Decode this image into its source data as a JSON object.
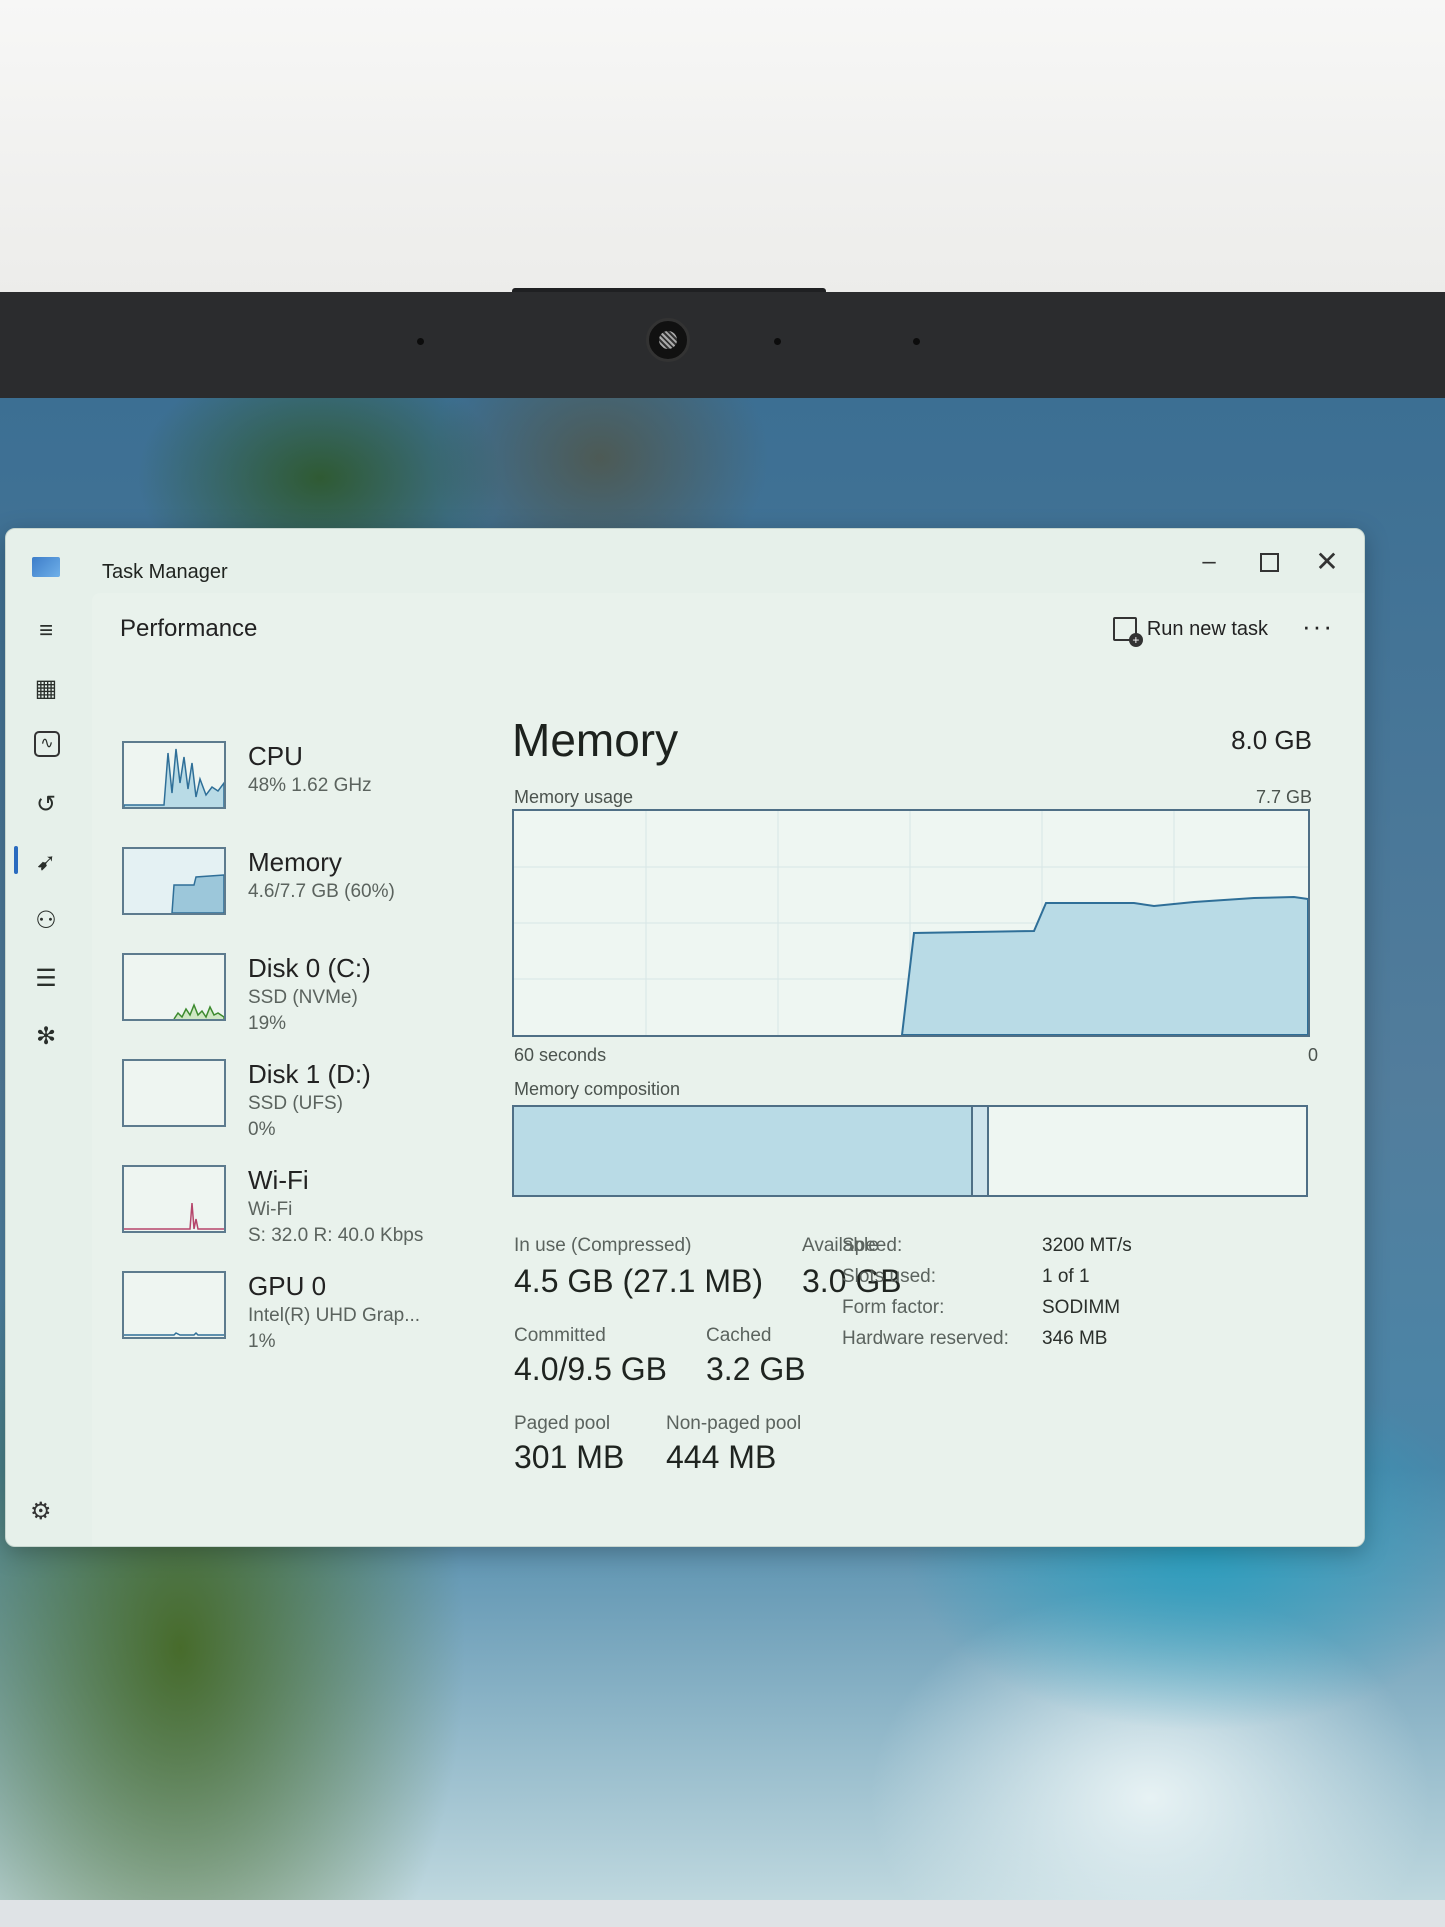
{
  "window": {
    "title": "Task Manager",
    "controls": [
      "minimize-icon",
      "maximize-icon",
      "close-icon"
    ]
  },
  "nav_icons": [
    "hamburger-icon",
    "processes-icon",
    "performance-icon",
    "app-history-icon",
    "startup-apps-icon",
    "users-icon",
    "details-icon",
    "services-icon",
    "settings-icon"
  ],
  "header": {
    "page_title": "Performance",
    "run_new_task_label": "Run new task",
    "more_label": "···"
  },
  "devices": [
    {
      "name": "CPU",
      "line1": "48%  1.62 GHz",
      "line2": ""
    },
    {
      "name": "Memory",
      "line1": "4.6/7.7 GB (60%)",
      "line2": ""
    },
    {
      "name": "Disk 0 (C:)",
      "line1": "SSD (NVMe)",
      "line2": "19%"
    },
    {
      "name": "Disk 1 (D:)",
      "line1": "SSD (UFS)",
      "line2": "0%"
    },
    {
      "name": "Wi-Fi",
      "line1": "Wi-Fi",
      "line2": "S: 32.0  R: 40.0 Kbps"
    },
    {
      "name": "GPU 0",
      "line1": "Intel(R) UHD Grap...",
      "line2": "1%"
    }
  ],
  "memory": {
    "title": "Memory",
    "total": "8.0 GB",
    "usage_label": "Memory usage",
    "usage_max": "7.7 GB",
    "axis_left": "60 seconds",
    "axis_right": "0",
    "composition_label": "Memory composition",
    "composition": {
      "in_use_fraction": 0.58,
      "modified_fraction": 0.02
    },
    "in_use_label": "In use (Compressed)",
    "in_use_value": "4.5 GB (27.1 MB)",
    "available_label": "Available",
    "available_value": "3.0 GB",
    "committed_label": "Committed",
    "committed_value": "4.0/9.5 GB",
    "cached_label": "Cached",
    "cached_value": "3.2 GB",
    "paged_label": "Paged pool",
    "paged_value": "301 MB",
    "nonpaged_label": "Non-paged pool",
    "nonpaged_value": "444 MB",
    "specs": [
      {
        "key": "Speed:",
        "value": "3200 MT/s"
      },
      {
        "key": "Slots used:",
        "value": "1 of 1"
      },
      {
        "key": "Form factor:",
        "value": "SODIMM"
      },
      {
        "key": "Hardware reserved:",
        "value": "346 MB"
      }
    ]
  }
}
